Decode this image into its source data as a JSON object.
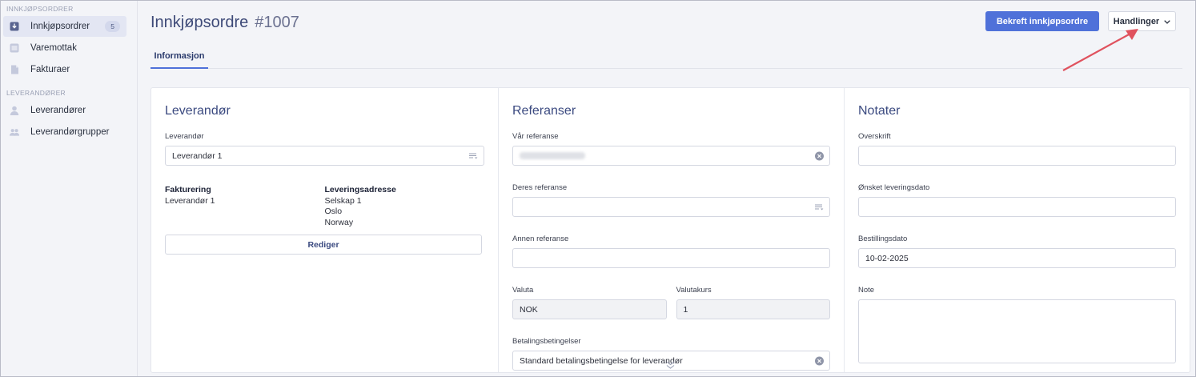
{
  "sidebar": {
    "section1": "INNKJØPSORDRER",
    "items1": [
      {
        "label": "Innkjøpsordrer",
        "badge": "5"
      },
      {
        "label": "Varemottak"
      },
      {
        "label": "Fakturaer"
      }
    ],
    "section2": "LEVERANDØRER",
    "items2": [
      {
        "label": "Leverandører"
      },
      {
        "label": "Leverandørgrupper"
      }
    ]
  },
  "header": {
    "title": "Innkjøpsordre",
    "number": "#1007",
    "primary_button": "Bekreft innkjøpsordre",
    "actions_button": "Handlinger"
  },
  "tabs": [
    {
      "label": "Informasjon"
    }
  ],
  "supplier": {
    "title": "Leverandør",
    "field_label": "Leverandør",
    "field_value": "Leverandør 1",
    "billing_heading": "Fakturering",
    "billing_lines": [
      "Leverandør 1"
    ],
    "delivery_heading": "Leveringsadresse",
    "delivery_lines": [
      "Selskap 1",
      "Oslo",
      "Norway"
    ],
    "edit_button": "Rediger"
  },
  "references": {
    "title": "Referanser",
    "our_ref_label": "Vår referanse",
    "their_ref_label": "Deres referanse",
    "their_ref_value": "",
    "other_ref_label": "Annen referanse",
    "other_ref_value": "",
    "currency_label": "Valuta",
    "currency_value": "NOK",
    "rate_label": "Valutakurs",
    "rate_value": "1",
    "payment_label": "Betalingsbetingelser",
    "payment_value": "Standard betalingsbetingelse for leverandør"
  },
  "notes": {
    "title": "Notater",
    "heading_label": "Overskrift",
    "heading_value": "",
    "delivery_date_label": "Ønsket leveringsdato",
    "delivery_date_value": "",
    "order_date_label": "Bestillingsdato",
    "order_date_value": "10-02-2025",
    "note_label": "Note",
    "note_value": ""
  },
  "colors": {
    "accent": "#4f71d9",
    "title": "#3b4a80",
    "annotation_arrow": "#e0525e"
  }
}
